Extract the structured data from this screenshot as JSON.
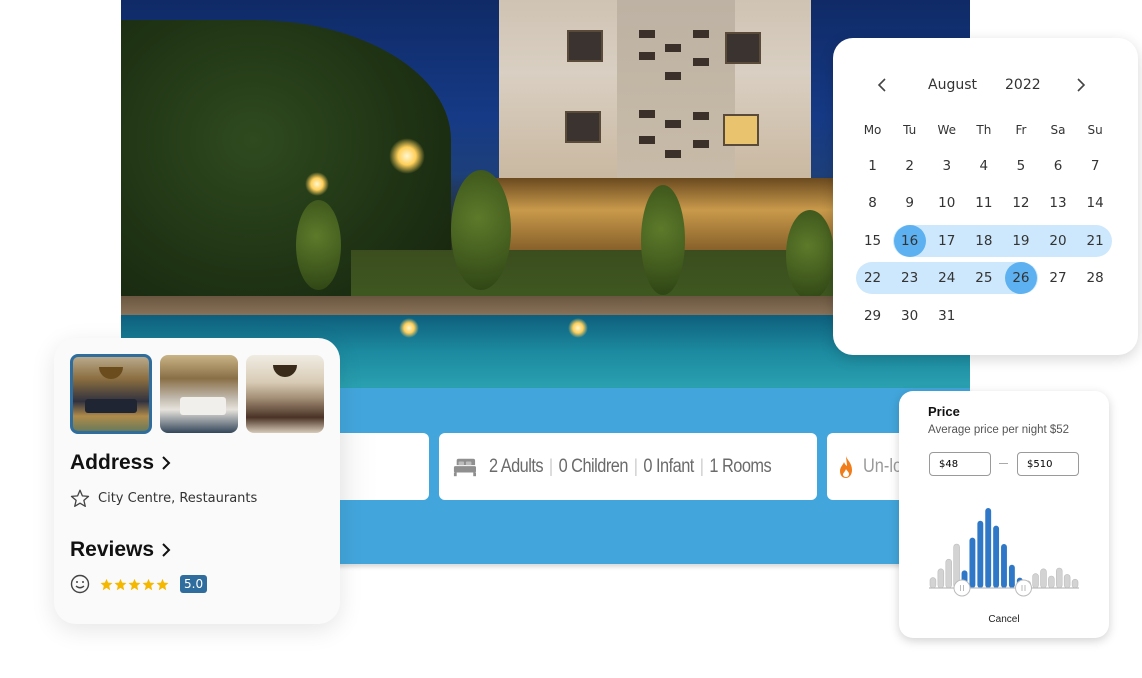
{
  "hero": {
    "alt": "Hotel exterior at night with swimming pool"
  },
  "search_bar": {
    "destination_value": "",
    "guests": {
      "icon": "bed-icon",
      "adults": "2 Adults",
      "children": "0 Children",
      "infants": "0 Infant",
      "rooms": "1 Rooms"
    },
    "deals": {
      "icon": "flame-icon",
      "label": "Un-lo"
    },
    "colors": {
      "bar": "#42a5db",
      "deal_icon": "#f07d1a"
    }
  },
  "info_card": {
    "thumbnails": [
      {
        "label": "Lobby lounge",
        "selected": true
      },
      {
        "label": "Bedroom suite",
        "selected": false
      },
      {
        "label": "Reception hall",
        "selected": false
      }
    ],
    "address_heading": "Address",
    "address_detail": "City Centre, Restaurants",
    "reviews_heading": "Reviews",
    "rating_stars": 5,
    "rating_max": 5,
    "rating_score": "5.0",
    "colors": {
      "accent": "#2f6d9e",
      "star": "#f5b800"
    }
  },
  "calendar": {
    "month": "August",
    "year": "2022",
    "weekdays": [
      "Mo",
      "Tu",
      "We",
      "Th",
      "Fr",
      "Sa",
      "Su"
    ],
    "weeks": [
      [
        "1",
        "2",
        "3",
        "4",
        "5",
        "6",
        "7"
      ],
      [
        "8",
        "9",
        "10",
        "11",
        "12",
        "13",
        "14"
      ],
      [
        "15",
        "16",
        "17",
        "18",
        "19",
        "20",
        "21"
      ],
      [
        "22",
        "23",
        "24",
        "25",
        "26",
        "27",
        "28"
      ],
      [
        "29",
        "30",
        "31",
        "",
        "",
        "",
        ""
      ]
    ],
    "range_start": 16,
    "range_end": 26,
    "colors": {
      "endpoint": "#5db1f0",
      "range": "#cde8fc"
    }
  },
  "price_filter": {
    "title": "Price",
    "subtitle": "Average price per night $52",
    "min_value": "$48",
    "max_value": "$510",
    "cancel_label": "Cancel",
    "histogram": {
      "bar_heights_relative": [
        0.13,
        0.24,
        0.36,
        0.55,
        0.22,
        0.63,
        0.84,
        1.0,
        0.78,
        0.55,
        0.29,
        0.13,
        0.09,
        0.18,
        0.24,
        0.15,
        0.25,
        0.17,
        0.11
      ],
      "selected_range_bars": [
        4,
        11
      ],
      "handle_positions_relative": [
        0.22,
        0.63
      ],
      "colors": {
        "selected": "#2e78c7",
        "unselected": "#d3d3d3"
      }
    }
  }
}
